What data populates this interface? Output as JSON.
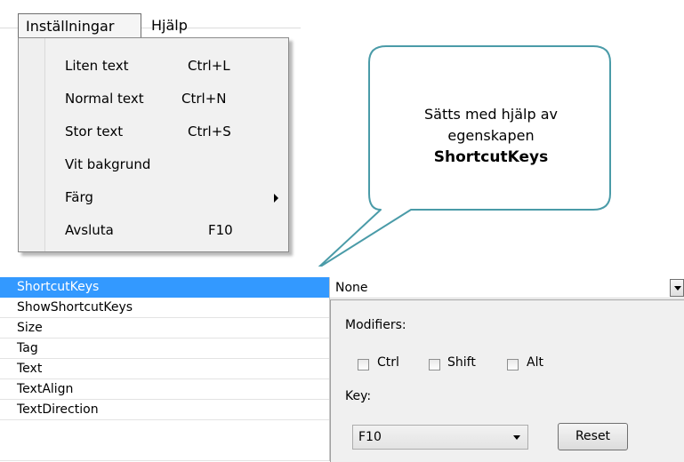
{
  "menubar": {
    "items": [
      {
        "label": "Inställningar"
      },
      {
        "label": "Hjälp"
      }
    ]
  },
  "dropdown": {
    "items": [
      {
        "label": "Liten text",
        "shortcut": "Ctrl+L"
      },
      {
        "label": "Normal text",
        "shortcut": "Ctrl+N"
      },
      {
        "label": "Stor text",
        "shortcut": "Ctrl+S"
      },
      {
        "label": "Vit bakgrund",
        "shortcut": ""
      },
      {
        "label": "Färg",
        "shortcut": "",
        "submenu": true
      },
      {
        "label": "Avsluta",
        "shortcut": "F10"
      }
    ]
  },
  "callout": {
    "line1": "Sätts med hjälp av",
    "line2": "egenskapen",
    "bold": "ShortcutKeys"
  },
  "property_grid": {
    "rows": [
      {
        "name": "ShortcutKeys",
        "selected": true
      },
      {
        "name": "ShowShortcutKeys"
      },
      {
        "name": "Size"
      },
      {
        "name": "Tag"
      },
      {
        "name": "Text"
      },
      {
        "name": "TextAlign"
      },
      {
        "name": "TextDirection"
      }
    ],
    "selected_value": "None"
  },
  "shortcut_editor": {
    "modifiers_label": "Modifiers:",
    "ctrl_label": "Ctrl",
    "shift_label": "Shift",
    "alt_label": "Alt",
    "key_label": "Key:",
    "key_value": "F10",
    "reset_label": "Reset"
  },
  "colors": {
    "selection": "#3399ff",
    "callout_border": "#4a9ba8"
  }
}
